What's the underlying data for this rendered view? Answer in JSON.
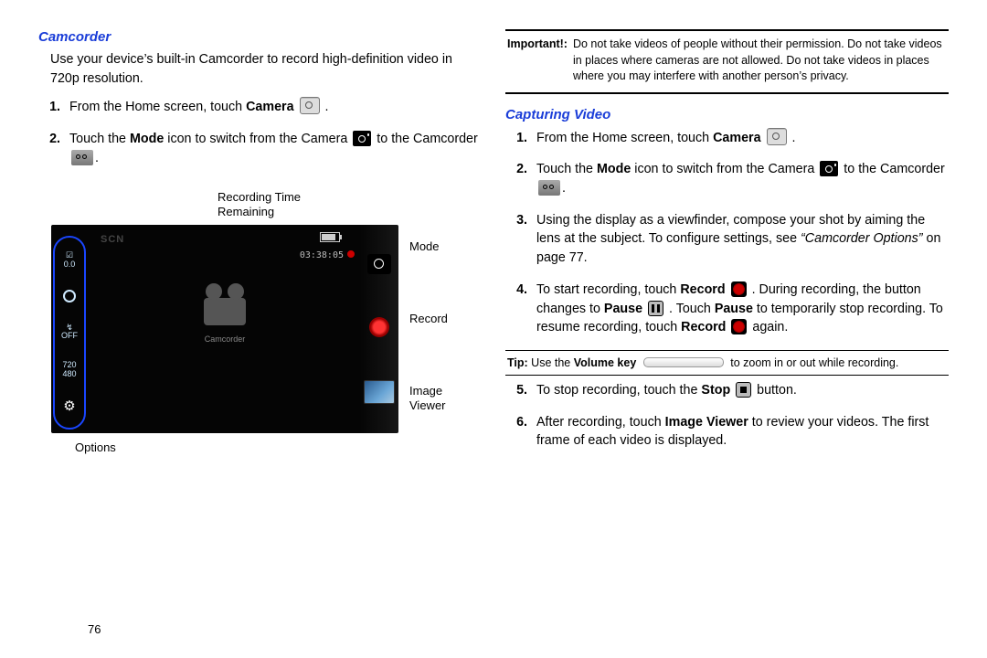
{
  "pageNumber": "76",
  "left": {
    "heading": "Camcorder",
    "intro": "Use your device’s built-in Camcorder to record high-definition video in 720p resolution.",
    "steps": [
      {
        "pre": "From the Home screen, touch ",
        "bold": "Camera",
        "post": " ."
      },
      {
        "pre": "Touch the ",
        "bold": "Mode",
        "mid": " icon to switch from the Camera ",
        "post2": " to the Camcorder ",
        "end": "."
      }
    ],
    "cam": {
      "topLabel1": "Recording Time",
      "topLabel2": "Remaining",
      "scn": "SCN",
      "time": "03:38:05",
      "centerLabel": "Camcorder",
      "rightLabels": {
        "mode": "Mode",
        "record": "Record",
        "image": "Image",
        "viewer": "Viewer"
      },
      "optionsLabel": "Options",
      "leftOptions": {
        "ev": "0.0",
        "flash": "OFF",
        "res1": "720",
        "res2": "480"
      }
    }
  },
  "right": {
    "importantTag": "Important!:",
    "importantText": "Do not take videos of people without their permission. Do not take videos in places where cameras are not allowed. Do not take videos in places where you may interfere with another person’s privacy.",
    "heading": "Capturing Video",
    "steps": {
      "s1_pre": "From the Home screen, touch ",
      "s1_bold": "Camera",
      "s1_post": " .",
      "s2_pre": "Touch the ",
      "s2_bold": "Mode",
      "s2_mid": " icon to switch from the Camera ",
      "s2_post": " to the Camcorder ",
      "s2_end": ".",
      "s3_a": "Using the display as a viewfinder, compose your shot by aiming the lens at the subject. To configure settings, see ",
      "s3_ref": "“Camcorder Options”",
      "s3_b": " on page 77.",
      "s4_a": "To start recording, touch ",
      "s4_rec": "Record",
      "s4_b": " . During recording, the button changes to ",
      "s4_pause": "Pause",
      "s4_c": " . Touch ",
      "s4_pause2": "Pause",
      "s4_d": " to temporarily stop recording. To resume recording, touch ",
      "s4_rec2": "Record",
      "s4_e": " again.",
      "s5_a": "To stop recording, touch the ",
      "s5_stop": "Stop",
      "s5_b": " button.",
      "s6_a": "After recording, touch ",
      "s6_iv": "Image Viewer",
      "s6_b": " to review your videos. The first frame of each video is displayed."
    },
    "tipTag": "Tip:",
    "tipA": " Use the ",
    "tipVol": "Volume key",
    "tipB": " to zoom in or out while recording."
  }
}
